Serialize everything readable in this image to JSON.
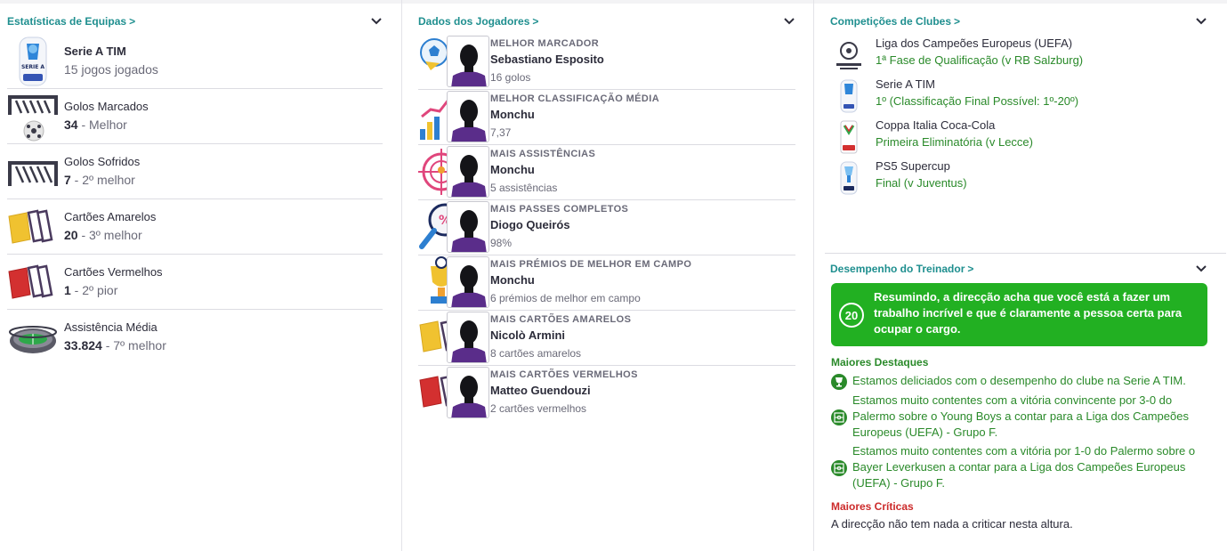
{
  "team_stats": {
    "title": "Estatísticas de Equipas",
    "gt": ">",
    "rows": [
      {
        "icon": "serie-a-logo-icon",
        "line1": "Serie A TIM",
        "value": "",
        "suffix": "15 jogos jogados"
      },
      {
        "icon": "goal-net-ball-icon",
        "line1": "Golos Marcados",
        "value": "34",
        "suffix": " - Melhor"
      },
      {
        "icon": "goal-net-icon",
        "line1": "Golos Sofridos",
        "value": "7",
        "suffix": " - 2º melhor"
      },
      {
        "icon": "yellow-cards-icon",
        "line1": "Cartões Amarelos",
        "value": "20",
        "suffix": " - 3º melhor"
      },
      {
        "icon": "red-cards-icon",
        "line1": "Cartões Vermelhos",
        "value": "1",
        "suffix": " - 2º pior"
      },
      {
        "icon": "stadium-icon",
        "line1": "Assistência Média",
        "value": "33.824",
        "suffix": " - 7º melhor"
      }
    ]
  },
  "player_data": {
    "title": "Dados dos Jogadores",
    "gt": ">",
    "rows": [
      {
        "icon": "soccer-balls-icon",
        "category": "MELHOR MARCADOR",
        "name": "Sebastiano Esposito",
        "value": "16 golos"
      },
      {
        "icon": "rating-chart-icon",
        "category": "MELHOR CLASSIFICAÇÃO MÉDIA",
        "name": "Monchu",
        "value": "7,37"
      },
      {
        "icon": "target-icon",
        "category": "MAIS ASSISTÊNCIAS",
        "name": "Monchu",
        "value": "5 assistências"
      },
      {
        "icon": "magnifier-percent-icon",
        "category": "MAIS PASSES COMPLETOS",
        "name": "Diogo Queirós",
        "value": "98%"
      },
      {
        "icon": "trophy-icon",
        "category": "MAIS PRÉMIOS DE MELHOR EM CAMPO",
        "name": "Monchu",
        "value": "6 prémios de melhor em campo"
      },
      {
        "icon": "yellow-card-icon",
        "category": "MAIS CARTÕES AMARELOS",
        "name": "Nicolò Armini",
        "value": "8 cartões amarelos"
      },
      {
        "icon": "red-card-icon",
        "category": "MAIS CARTÕES VERMELHOS",
        "name": "Matteo Guendouzi",
        "value": "2 cartões vermelhos"
      }
    ]
  },
  "club_comps": {
    "title": "Competições de Clubes",
    "gt": ">",
    "rows": [
      {
        "icon": "champions-league-icon",
        "name": "Liga dos Campeões Europeus (UEFA)",
        "stage": "1ª Fase de Qualificação (v RB Salzburg)"
      },
      {
        "icon": "serie-a-logo-icon",
        "name": "Serie A TIM",
        "stage": "1º (Classificação Final Possível: 1º-20º)"
      },
      {
        "icon": "coppa-italia-icon",
        "name": "Coppa Italia Coca-Cola",
        "stage": "Primeira Eliminatória (v Lecce)"
      },
      {
        "icon": "supercup-icon",
        "name": "PS5 Supercup",
        "stage": "Final (v Juventus)"
      }
    ]
  },
  "manager": {
    "title": "Desempenho do Treinador",
    "gt": ">",
    "score": "20",
    "summary": "Resumindo, a direcção acha que você está a fazer um trabalho incrível e que é claramente a pessoa certa para ocupar o cargo.",
    "highlights_title": "Maiores Destaques",
    "highlights": [
      {
        "icon": "trophy-icon",
        "text": "Estamos deliciados com o desempenho do clube na Serie A TIM."
      },
      {
        "icon": "pitch-icon",
        "text": "Estamos muito contentes com a vitória convincente por 3-0 do Palermo sobre o Young Boys a contar para a Liga dos Campeões Europeus (UEFA) - Grupo F."
      },
      {
        "icon": "pitch-icon",
        "text": "Estamos muito contentes com a vitória por 1-0 do Palermo sobre o Bayer Leverkusen a contar para a Liga dos Campeões Europeus (UEFA) - Grupo F."
      }
    ],
    "criticisms_title": "Maiores Críticas",
    "criticisms": "A direcção não tem nada a criticar nesta altura."
  },
  "colors": {
    "accent": "#1f8f8f",
    "positive": "#2a8a2a",
    "banner": "#22b022",
    "negative": "#cc2b2b",
    "avatar_shirt": "#5a2d8a"
  }
}
